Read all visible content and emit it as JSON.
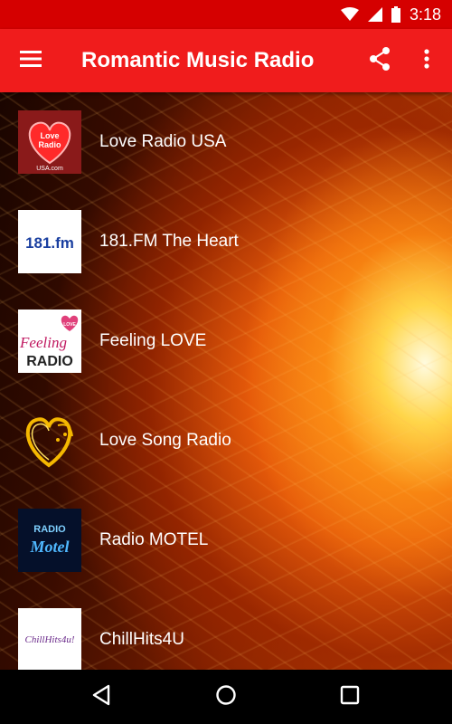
{
  "status_bar": {
    "time": "3:18",
    "background": "#d50000"
  },
  "app_bar": {
    "title": "Romantic Music Radio",
    "background": "#f01c1c",
    "menu_icon": "menu-icon",
    "share_icon": "share-icon",
    "more_icon": "more-vert-icon"
  },
  "stations": [
    {
      "name": "Love Radio USA",
      "logo": "love-radio-usa-logo",
      "logo_text": [
        "Love",
        "Radio",
        "USA.com"
      ]
    },
    {
      "name": "181.FM The Heart",
      "logo": "181fm-logo",
      "logo_text": [
        "181.fm"
      ]
    },
    {
      "name": "Feeling LOVE",
      "logo": "feeling-love-logo",
      "logo_text": [
        "Feeling",
        "RADIO",
        "LOVE"
      ]
    },
    {
      "name": "Love Song Radio",
      "logo": "golden-heart-logo",
      "logo_text": []
    },
    {
      "name": "Radio MOTEL",
      "logo": "radio-motel-logo",
      "logo_text": [
        "RADIO",
        "Motel"
      ]
    },
    {
      "name": "ChillHits4U",
      "logo": "chillhits4u-logo",
      "logo_text": [
        "ChillHits4u!"
      ]
    }
  ],
  "nav_bar": {
    "back_icon": "back-triangle-icon",
    "home_icon": "home-circle-icon",
    "recents_icon": "recents-square-icon"
  }
}
